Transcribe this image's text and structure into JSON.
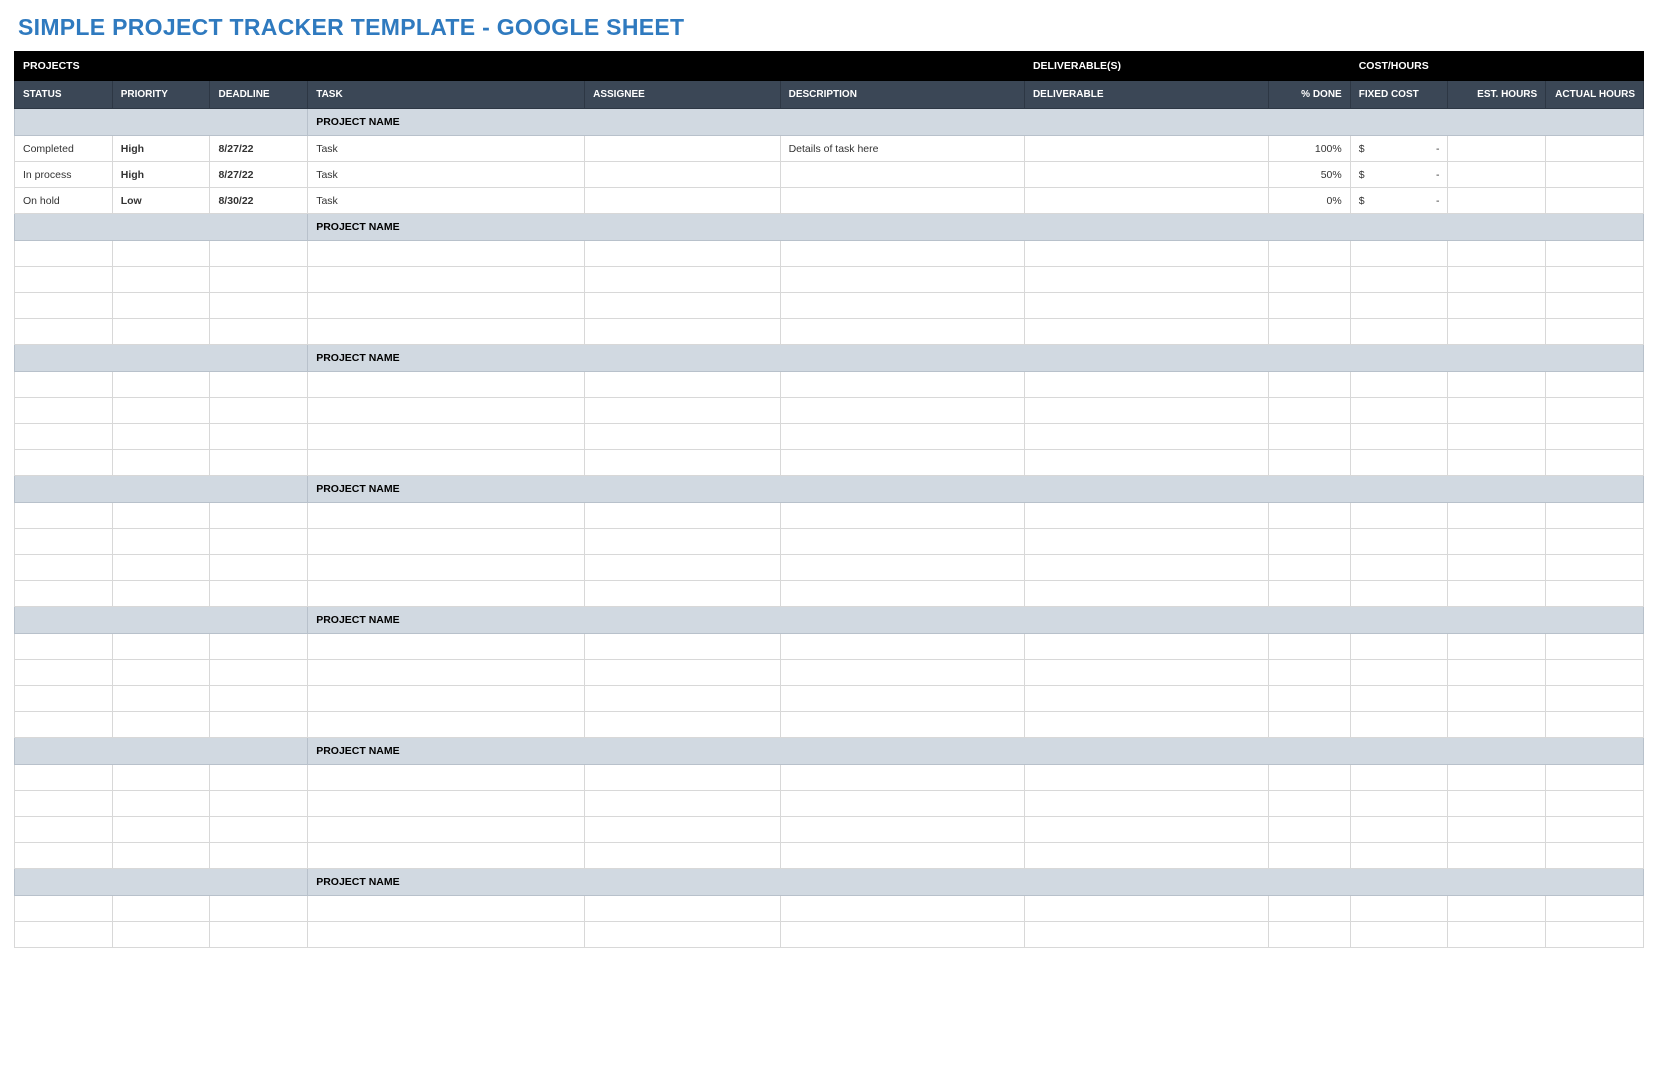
{
  "title": "SIMPLE PROJECT TRACKER TEMPLATE - GOOGLE SHEET",
  "groupHeaders": {
    "projects": "PROJECTS",
    "deliverables": "DELIVERABLE(S)",
    "costHours": "COST/HOURS"
  },
  "columns": {
    "status": "STATUS",
    "priority": "PRIORITY",
    "deadline": "DEADLINE",
    "task": "TASK",
    "assignee": "ASSIGNEE",
    "description": "DESCRIPTION",
    "deliverable": "DELIVERABLE",
    "pctDone": "% DONE",
    "fixedCost": "FIXED COST",
    "estHours": "EST. HOURS",
    "actualHours": "ACTUAL HOURS"
  },
  "sections": [
    {
      "projectName": "PROJECT NAME",
      "rows": [
        {
          "status": "Completed",
          "priority": "High",
          "priorityClass": "priority-high",
          "deadline": "8/27/22",
          "task": "Task",
          "assignee": "",
          "description": "Details of task here",
          "deliverable": "",
          "pctDone": "100%",
          "fixedCostSym": "$",
          "fixedCostVal": "-",
          "estHours": "",
          "actualHours": ""
        },
        {
          "status": "In process",
          "priority": "High",
          "priorityClass": "priority-high",
          "deadline": "8/27/22",
          "task": "Task",
          "assignee": "",
          "description": "",
          "deliverable": "",
          "pctDone": "50%",
          "fixedCostSym": "$",
          "fixedCostVal": "-",
          "estHours": "",
          "actualHours": ""
        },
        {
          "status": "On hold",
          "priority": "Low",
          "priorityClass": "priority-low",
          "deadline": "8/30/22",
          "task": "Task",
          "assignee": "",
          "description": "",
          "deliverable": "",
          "pctDone": "0%",
          "fixedCostSym": "$",
          "fixedCostVal": "-",
          "estHours": "",
          "actualHours": ""
        }
      ],
      "emptyRows": 0
    },
    {
      "projectName": "PROJECT NAME",
      "rows": [],
      "emptyRows": 4
    },
    {
      "projectName": "PROJECT NAME",
      "rows": [],
      "emptyRows": 4
    },
    {
      "projectName": "PROJECT NAME",
      "rows": [],
      "emptyRows": 4
    },
    {
      "projectName": "PROJECT NAME",
      "rows": [],
      "emptyRows": 4
    },
    {
      "projectName": "PROJECT NAME",
      "rows": [],
      "emptyRows": 4
    },
    {
      "projectName": "PROJECT NAME",
      "rows": [],
      "emptyRows": 2
    }
  ]
}
